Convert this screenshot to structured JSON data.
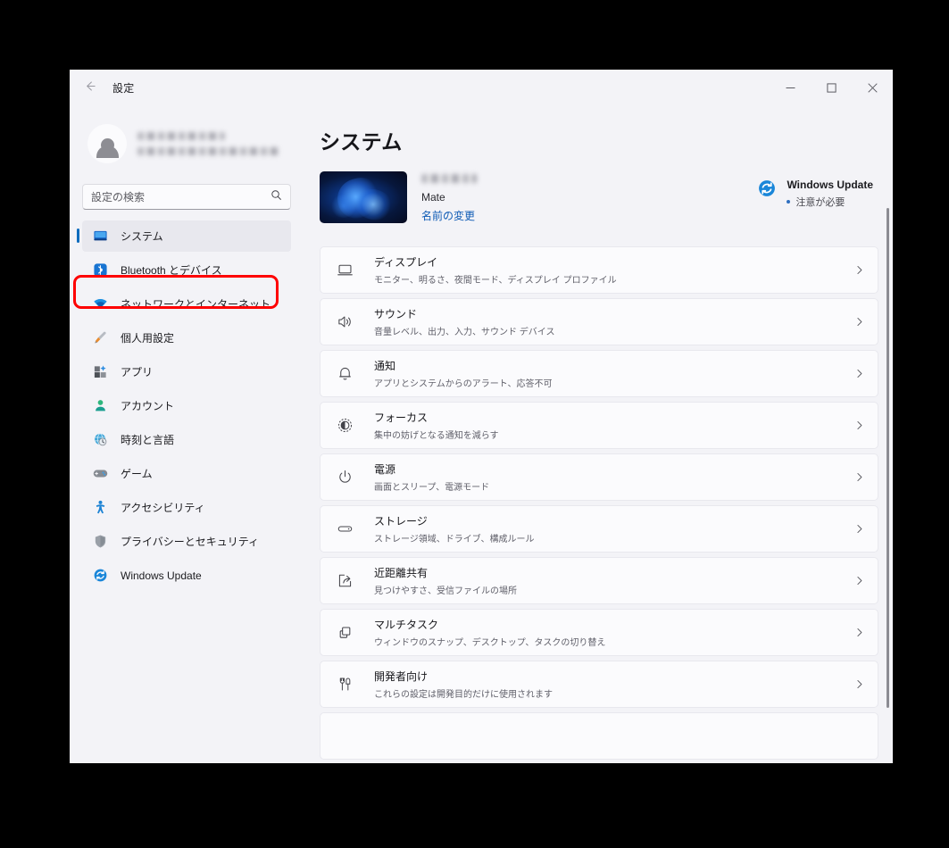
{
  "window": {
    "titlebar": {
      "title": "設定",
      "back_icon": "arrow-left-icon",
      "minimize_label": "─",
      "maximize_label": "☐",
      "close_label": "✕"
    }
  },
  "sidebar": {
    "user": {
      "name_redacted": "",
      "email_redacted": "",
      "avatar_icon": "person-avatar-icon"
    },
    "search": {
      "placeholder": "設定の検索",
      "value": "",
      "icon": "search-icon"
    },
    "items": [
      {
        "label": "システム",
        "icon": "monitor-icon",
        "active": true,
        "highlighted": false
      },
      {
        "label": "Bluetooth とデバイス",
        "icon": "bluetooth-icon",
        "active": false,
        "highlighted": false
      },
      {
        "label": "ネットワークとインターネット",
        "icon": "wifi-icon",
        "active": false,
        "highlighted": true
      },
      {
        "label": "個人用設定",
        "icon": "paintbrush-icon",
        "active": false,
        "highlighted": false
      },
      {
        "label": "アプリ",
        "icon": "apps-icon",
        "active": false,
        "highlighted": false
      },
      {
        "label": "アカウント",
        "icon": "account-person-icon",
        "active": false,
        "highlighted": false
      },
      {
        "label": "時刻と言語",
        "icon": "clock-globe-icon",
        "active": false,
        "highlighted": false
      },
      {
        "label": "ゲーム",
        "icon": "gamepad-icon",
        "active": false,
        "highlighted": false
      },
      {
        "label": "アクセシビリティ",
        "icon": "accessibility-person-icon",
        "active": false,
        "highlighted": false
      },
      {
        "label": "プライバシーとセキュリティ",
        "icon": "shield-icon",
        "active": false,
        "highlighted": false
      },
      {
        "label": "Windows Update",
        "icon": "update-refresh-icon",
        "active": false,
        "highlighted": false
      }
    ]
  },
  "main": {
    "page_title": "システム",
    "device": {
      "name_redacted": "",
      "model": "Mate",
      "rename_link": "名前の変更",
      "thumbnail_icon": "windows-bloom-wallpaper-thumbnail"
    },
    "windows_update": {
      "title": "Windows Update",
      "status": "注意が必要",
      "icon": "update-refresh-icon",
      "dot_color": "#2f6fc0"
    },
    "settings_rows": [
      {
        "title": "ディスプレイ",
        "subtitle": "モニター、明るさ、夜間モード、ディスプレイ プロファイル",
        "icon": "monitor-outline-icon"
      },
      {
        "title": "サウンド",
        "subtitle": "音量レベル、出力、入力、サウンド デバイス",
        "icon": "speaker-icon"
      },
      {
        "title": "通知",
        "subtitle": "アプリとシステムからのアラート、応答不可",
        "icon": "bell-icon"
      },
      {
        "title": "フォーカス",
        "subtitle": "集中の妨げとなる通知を減らす",
        "icon": "focus-moon-icon"
      },
      {
        "title": "電源",
        "subtitle": "画面とスリープ、電源モード",
        "icon": "power-icon"
      },
      {
        "title": "ストレージ",
        "subtitle": "ストレージ領域、ドライブ、構成ルール",
        "icon": "drive-icon"
      },
      {
        "title": "近距離共有",
        "subtitle": "見つけやすさ、受信ファイルの場所",
        "icon": "share-icon"
      },
      {
        "title": "マルチタスク",
        "subtitle": "ウィンドウのスナップ、デスクトップ、タスクの切り替え",
        "icon": "windows-stack-icon"
      },
      {
        "title": "開発者向け",
        "subtitle": "これらの設定は開発目的だけに使用されます",
        "icon": "tools-icon"
      }
    ],
    "chevron_icon": "chevron-right-icon"
  },
  "annotation": {
    "highlight_color": "#fe0000",
    "target_label": "ネットワークとインターネット"
  },
  "colors": {
    "window_bg": "#f3f3f7",
    "card_bg": "#fbfbfd",
    "accent": "#0f6cbd",
    "link": "#0f5bb5",
    "text_primary": "#16161a",
    "text_secondary": "#60606a"
  }
}
